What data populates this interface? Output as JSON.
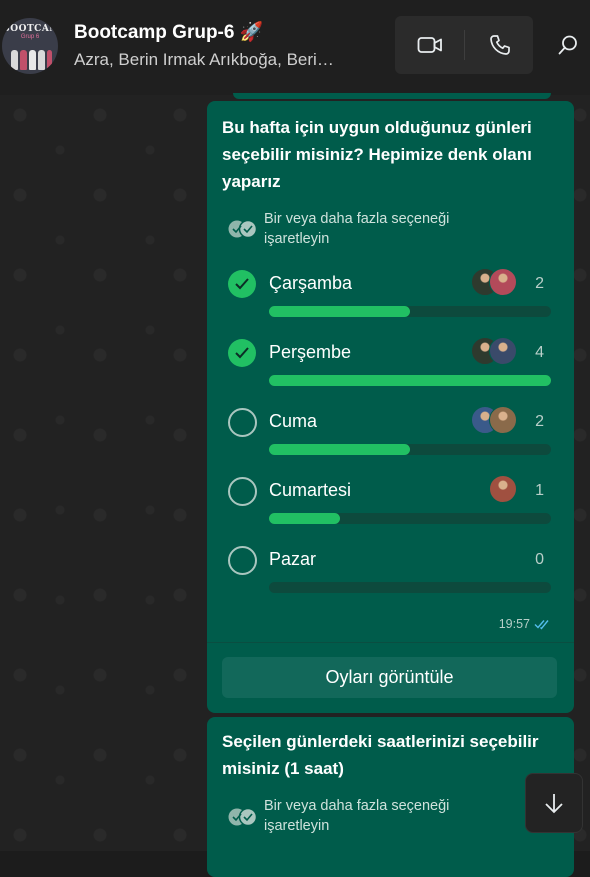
{
  "header": {
    "group_name": "Bootcamp Grup-6 🚀",
    "members": "Azra, Berin Irmak Arıkboğa, Beri…",
    "avatar_logo": "BOOTCAMP",
    "avatar_sub": "Grup 6"
  },
  "poll1": {
    "question": "Bu hafta için uygun olduğunuz günleri seçebilir misiniz? Hepimize denk olanı yaparız",
    "hint": "Bir veya daha fazla seçeneği işaretleyin",
    "options": [
      {
        "label": "Çarşamba",
        "count": "2",
        "checked": true,
        "fraction": 0.5,
        "voters": [
          "#2e3a2e",
          "#b34a5a"
        ]
      },
      {
        "label": "Perşembe",
        "count": "4",
        "checked": true,
        "fraction": 1.0,
        "voters": [
          "#2e3a2e",
          "#3a4a6a"
        ]
      },
      {
        "label": "Cuma",
        "count": "2",
        "checked": false,
        "fraction": 0.5,
        "voters": [
          "#3a5a8a",
          "#8a6a4a"
        ]
      },
      {
        "label": "Cumartesi",
        "count": "1",
        "checked": false,
        "fraction": 0.25,
        "voters": [
          "#a05040"
        ]
      },
      {
        "label": "Pazar",
        "count": "0",
        "checked": false,
        "fraction": 0.0,
        "voters": []
      }
    ],
    "time": "19:57",
    "view_votes_label": "Oyları görüntüle"
  },
  "poll2": {
    "question": "Seçilen günlerdeki saatlerinizi seçebilir misiniz  (1 saat)",
    "hint": "Bir veya daha fazla seçeneği işaretleyin"
  },
  "colors": {
    "bubble": "#005c4b",
    "accent": "#21c063"
  }
}
